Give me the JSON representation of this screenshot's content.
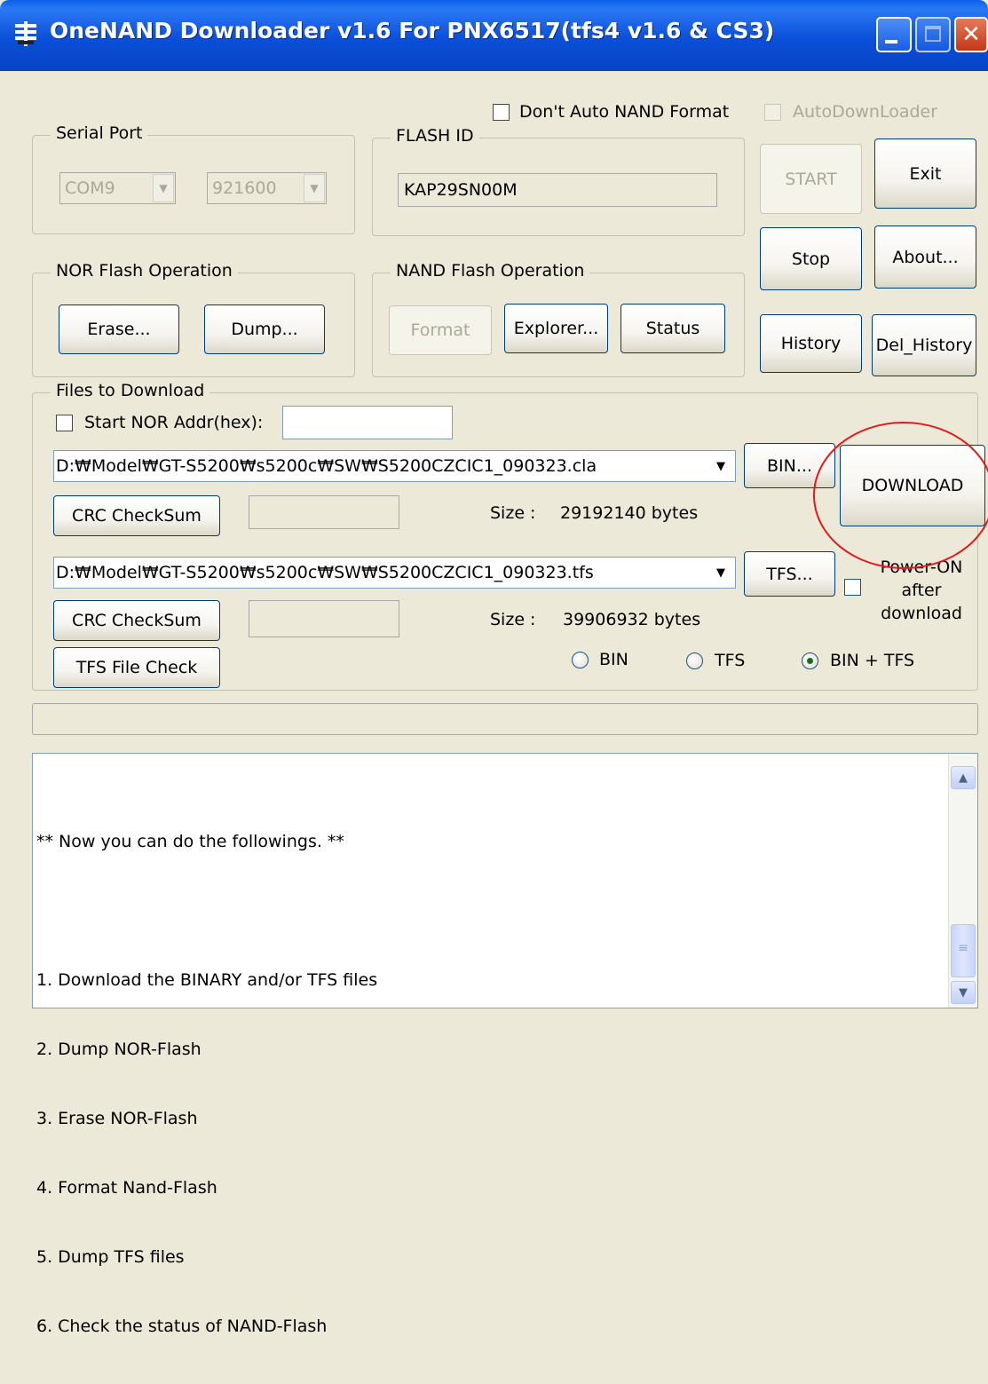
{
  "window": {
    "title": "OneNAND Downloader v1.6 For PNX6517(tfs4 v1.6 & CS3)"
  },
  "options": {
    "dont_auto_nand_format": "Don't Auto NAND Format",
    "auto_downloader": "AutoDownLoader"
  },
  "serial_port": {
    "legend": "Serial Port",
    "port": "COM9",
    "baud": "921600"
  },
  "flash_id": {
    "legend": "FLASH ID",
    "value": "KAP29SN00M"
  },
  "right_buttons": {
    "start": "START",
    "exit": "Exit",
    "stop": "Stop",
    "about": "About...",
    "history": "History",
    "del_history": "Del_History"
  },
  "nor_flash": {
    "legend": "NOR Flash Operation",
    "erase": "Erase...",
    "dump": "Dump..."
  },
  "nand_flash": {
    "legend": "NAND Flash Operation",
    "format": "Format",
    "explorer": "Explorer...",
    "status": "Status"
  },
  "files": {
    "legend": "Files to Download",
    "start_nor_label": "Start NOR Addr(hex):",
    "bin_path": "D:₩Model₩GT-S5200₩s5200c₩SW₩S5200CZCIC1_090323.cla",
    "bin_button": "BIN...",
    "crc_button": "CRC CheckSum",
    "bin_size_label": "Size :",
    "bin_size_value": "29192140 bytes",
    "tfs_path": "D:₩Model₩GT-S5200₩s5200c₩SW₩S5200CZCIC1_090323.tfs",
    "tfs_button": "TFS...",
    "tfs_size_label": "Size :",
    "tfs_size_value": "39906932 bytes",
    "tfs_file_check": "TFS File Check",
    "download": "DOWNLOAD",
    "power_on": [
      "Power-ON",
      "after",
      "download"
    ],
    "radio_bin": "BIN",
    "radio_tfs": "TFS",
    "radio_bin_tfs": "BIN + TFS",
    "selected_mode": "BIN + TFS"
  },
  "log": {
    "lines": [
      "** Now you can do the followings. **",
      "",
      "1. Download the BINARY and/or TFS files",
      "2. Dump NOR-Flash",
      "3. Erase NOR-Flash",
      "4. Format Nand-Flash",
      "5. Dump TFS files",
      "6. Check the status of NAND-Flash"
    ]
  },
  "icons": {
    "scroll_up": "scroll-up-icon",
    "scroll_down": "scroll-down-icon",
    "app": "app-icon"
  },
  "colors": {
    "titlebar": "#0b4fd8",
    "annotation": "#e31a1a",
    "window_bg": "#ece9d8"
  }
}
